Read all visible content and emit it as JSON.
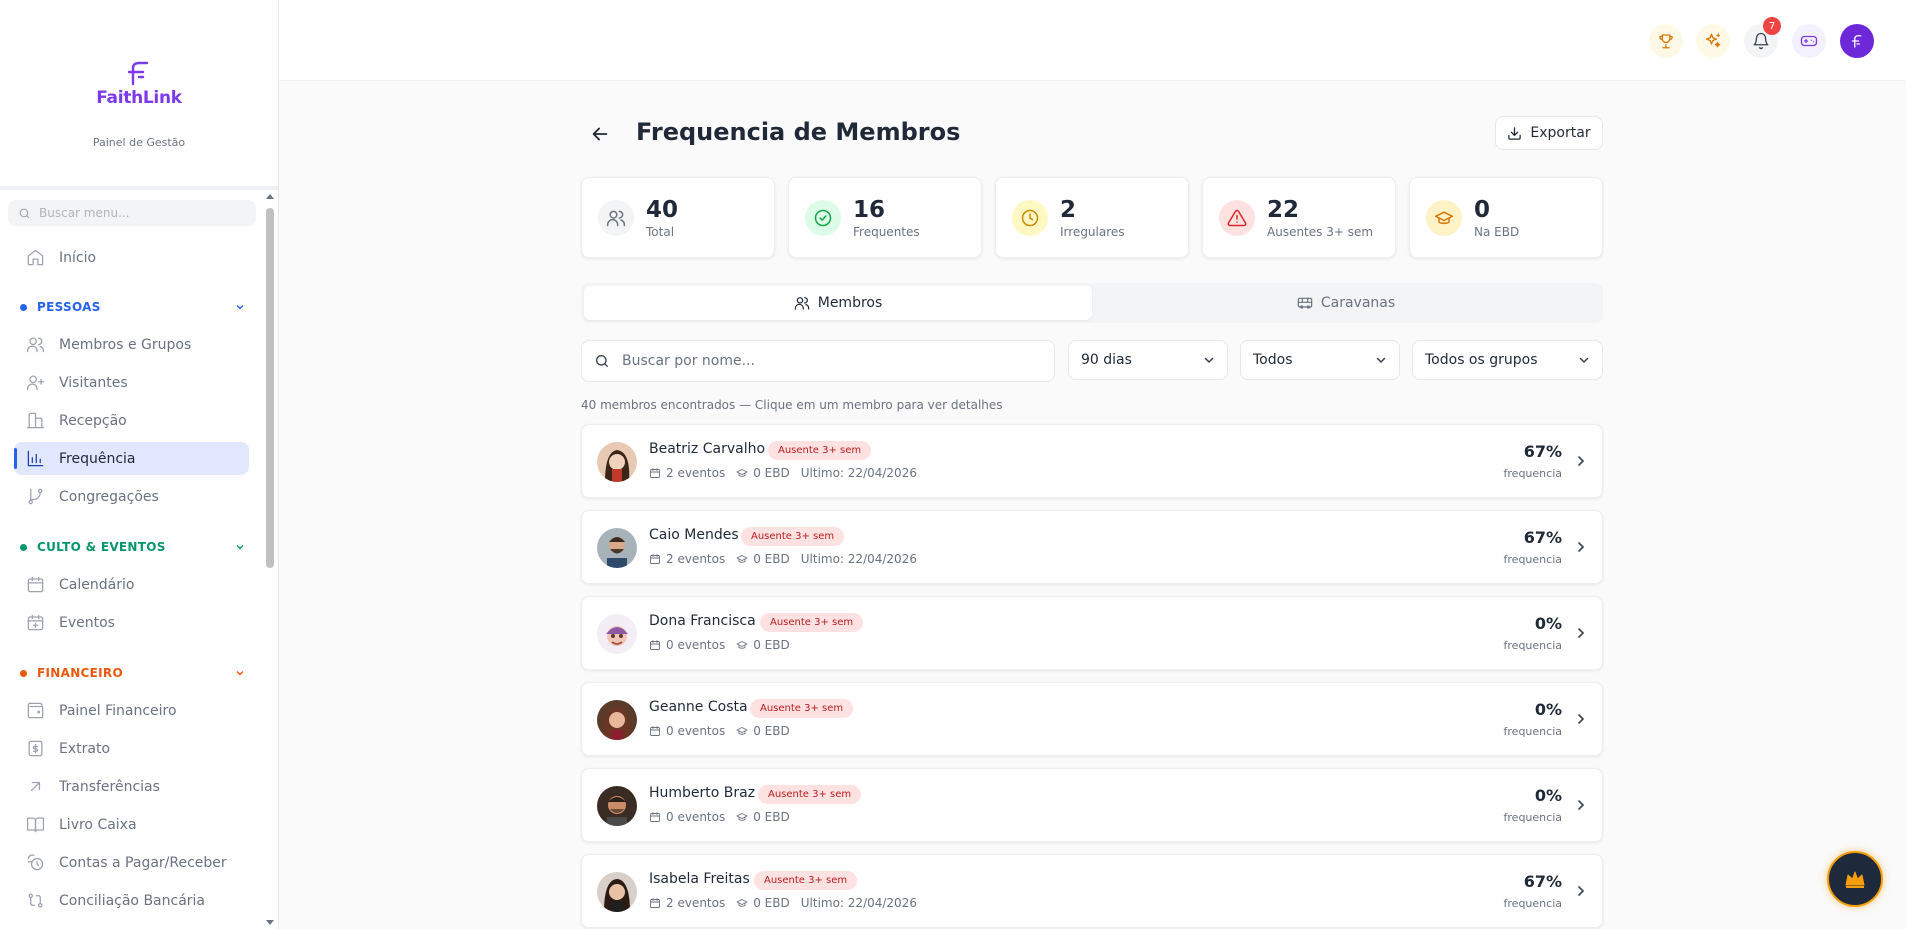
{
  "brand": {
    "name": "FaithLink",
    "subtitle": "Painel de Gestão"
  },
  "sidebar": {
    "search_placeholder": "Buscar menu...",
    "home": "Início",
    "sections": [
      {
        "label": "PESSOAS",
        "color": "#2563eb"
      },
      {
        "label": "CULTO & EVENTOS",
        "color": "#059669"
      },
      {
        "label": "FINANCEIRO",
        "color": "#ea580c"
      }
    ],
    "items": [
      {
        "label": "Membros e Grupos",
        "icon": "users-icon"
      },
      {
        "label": "Visitantes",
        "icon": "user-plus-icon"
      },
      {
        "label": "Recepção",
        "icon": "reception-icon"
      },
      {
        "label": "Frequência",
        "icon": "bar-chart-icon",
        "active": true
      },
      {
        "label": "Congregações",
        "icon": "git-branch-icon"
      },
      {
        "label": "Calendário",
        "icon": "calendar-icon"
      },
      {
        "label": "Eventos",
        "icon": "calendar-plus-icon"
      },
      {
        "label": "Painel Financeiro",
        "icon": "wallet-icon"
      },
      {
        "label": "Extrato",
        "icon": "receipt-icon"
      },
      {
        "label": "Transferências",
        "icon": "arrow-up-right-icon"
      },
      {
        "label": "Livro Caixa",
        "icon": "book-icon"
      },
      {
        "label": "Contas a Pagar/Receber",
        "icon": "clock-coin-icon"
      },
      {
        "label": "Conciliação Bancária",
        "icon": "git-compare-icon"
      }
    ]
  },
  "topbar": {
    "notification_count": "7"
  },
  "page": {
    "title": "Frequencia de Membros",
    "export_label": "Exportar"
  },
  "stats": [
    {
      "value": "40",
      "label": "Total",
      "icon": "users-icon",
      "color": "#6b7280"
    },
    {
      "value": "16",
      "label": "Frequentes",
      "icon": "check-circle-icon",
      "color": "#16a34a"
    },
    {
      "value": "2",
      "label": "Irregulares",
      "icon": "clock-icon",
      "color": "#ca8a04"
    },
    {
      "value": "22",
      "label": "Ausentes 3+ sem",
      "icon": "alert-triangle-icon",
      "color": "#dc2626"
    },
    {
      "value": "0",
      "label": "Na EBD",
      "icon": "graduation-cap-icon",
      "color": "#d97706"
    }
  ],
  "tabs": [
    {
      "label": "Membros",
      "active": true
    },
    {
      "label": "Caravanas",
      "active": false
    }
  ],
  "filters": {
    "search_placeholder": "Buscar por nome...",
    "period": "90 dias",
    "status": "Todos",
    "group": "Todos os grupos"
  },
  "count_text": "40 membros encontrados — Clique em um membro para ver detalhes",
  "members": [
    {
      "name": "Beatriz Carvalho",
      "badge": "Ausente 3+ sem",
      "events": "2 eventos",
      "ebd": "0 EBD",
      "last": "Ultimo: 22/04/2026",
      "pct": "67%",
      "pct_label": "frequencia"
    },
    {
      "name": "Caio Mendes",
      "badge": "Ausente 3+ sem",
      "events": "2 eventos",
      "ebd": "0 EBD",
      "last": "Ultimo: 22/04/2026",
      "pct": "67%",
      "pct_label": "frequencia"
    },
    {
      "name": "Dona Francisca",
      "badge": "Ausente 3+ sem",
      "events": "0 eventos",
      "ebd": "0 EBD",
      "last": "",
      "pct": "0%",
      "pct_label": "frequencia"
    },
    {
      "name": "Geanne Costa",
      "badge": "Ausente 3+ sem",
      "events": "0 eventos",
      "ebd": "0 EBD",
      "last": "",
      "pct": "0%",
      "pct_label": "frequencia"
    },
    {
      "name": "Humberto Braz",
      "badge": "Ausente 3+ sem",
      "events": "0 eventos",
      "ebd": "0 EBD",
      "last": "",
      "pct": "0%",
      "pct_label": "frequencia"
    },
    {
      "name": "Isabela Freitas",
      "badge": "Ausente 3+ sem",
      "events": "2 eventos",
      "ebd": "0 EBD",
      "last": "Ultimo: 22/04/2026",
      "pct": "67%",
      "pct_label": "frequencia"
    }
  ]
}
